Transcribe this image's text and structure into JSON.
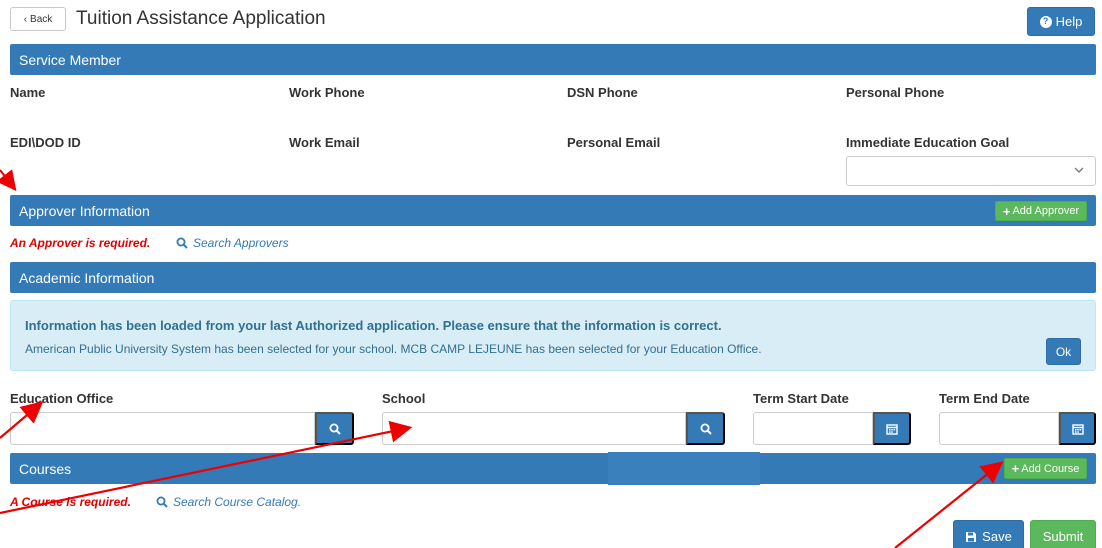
{
  "header": {
    "back_label": "Back",
    "title": "Tuition Assistance Application",
    "help_label": "Help"
  },
  "service_member": {
    "bar_title": "Service Member",
    "fields": {
      "name": "Name",
      "work_phone": "Work Phone",
      "dsn_phone": "DSN Phone",
      "personal_phone": "Personal Phone",
      "edi_id": "EDI\\DOD ID",
      "work_email": "Work Email",
      "personal_email": "Personal Email",
      "education_goal": "Immediate Education Goal"
    },
    "education_goal_value": ""
  },
  "approver": {
    "bar_title": "Approver Information",
    "add_label": "Add Approver",
    "error": "An Approver is required.",
    "search_link": "Search Approvers"
  },
  "academic": {
    "bar_title": "Academic Information",
    "info_title": "Information has been loaded from your last Authorized application. Please ensure that the information is correct.",
    "info_body": "American Public University System has been selected for your school. MCB CAMP LEJEUNE has been selected for your Education Office.",
    "ok_label": "Ok",
    "education_office_label": "Education Office",
    "school_label": "School",
    "term_start_label": "Term Start Date",
    "term_end_label": "Term End Date",
    "education_office_value": "",
    "school_value": "",
    "term_start_value": "",
    "term_end_value": ""
  },
  "courses": {
    "bar_title": "Courses",
    "add_label": "Add Course",
    "error": "A Course is required.",
    "search_link": "Search Course Catalog."
  },
  "footer": {
    "save_label": "Save",
    "submit_label": "Submit"
  },
  "colors": {
    "primary": "#337ab7",
    "success": "#5cb85c",
    "danger": "#e00000",
    "info_bg": "#d9edf7",
    "annotation": "#ee0000"
  },
  "icons": [
    "chevron-left-icon",
    "question-circle-icon",
    "plus-icon",
    "search-icon",
    "calendar-icon",
    "floppy-disk-icon",
    "chevron-down-icon"
  ]
}
